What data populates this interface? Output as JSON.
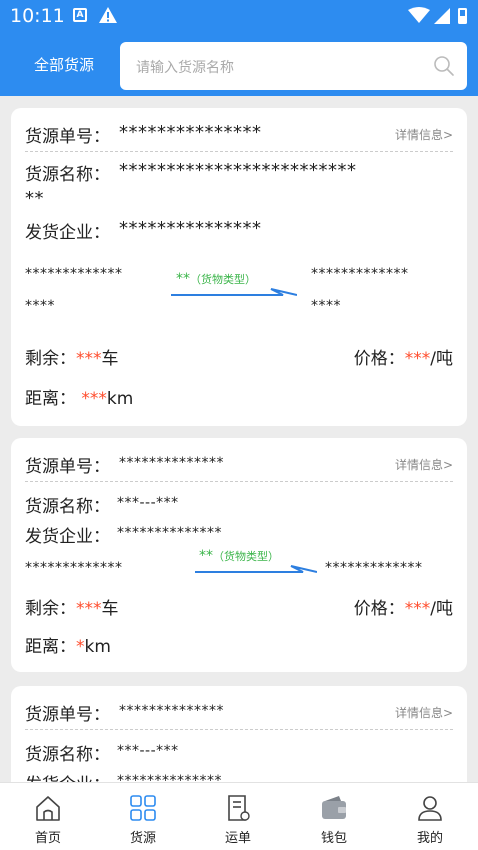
{
  "status": {
    "time": "10:11"
  },
  "header": {
    "all_sources": "全部货源",
    "search_placeholder": "请输入货源名称"
  },
  "labels": {
    "source_no": "货源单号：",
    "source_name": "货源名称：",
    "shipper": "发货企业：",
    "remaining": "剩余：",
    "price": "价格：",
    "distance": "距离：",
    "detail": "详情信息>",
    "cargo_type": "（货物类型）"
  },
  "cards": [
    {
      "source_no": "***************",
      "source_name_line1": "*************************",
      "source_name_line2": "**",
      "shipper": "***************",
      "from_line1": "*************",
      "from_line2": "****",
      "to_line1": "*************",
      "to_line2": "****",
      "cargo_stars": "**",
      "remaining": "***",
      "remaining_unit": "车",
      "price": "***",
      "price_unit": "/吨",
      "distance": "***",
      "distance_unit": "km"
    },
    {
      "source_no": "**************",
      "source_name": "***---***",
      "shipper": "**************",
      "from": "*************",
      "to": "*************",
      "cargo_stars": "**",
      "remaining": "***",
      "remaining_unit": "车",
      "price": "***",
      "price_unit": "/吨",
      "distance": "*",
      "distance_unit": "km"
    },
    {
      "source_no": "**************",
      "source_name": "***---***",
      "shipper": "**************"
    }
  ],
  "nav": [
    {
      "label": "首页",
      "icon": "home-icon"
    },
    {
      "label": "货源",
      "icon": "grid-icon"
    },
    {
      "label": "运单",
      "icon": "waybill-icon"
    },
    {
      "label": "钱包",
      "icon": "wallet-icon"
    },
    {
      "label": "我的",
      "icon": "user-icon"
    }
  ],
  "colors": {
    "primary": "#2d8cf0",
    "accent_red": "#ff4d2d",
    "cargo_green": "#3bb54a"
  }
}
